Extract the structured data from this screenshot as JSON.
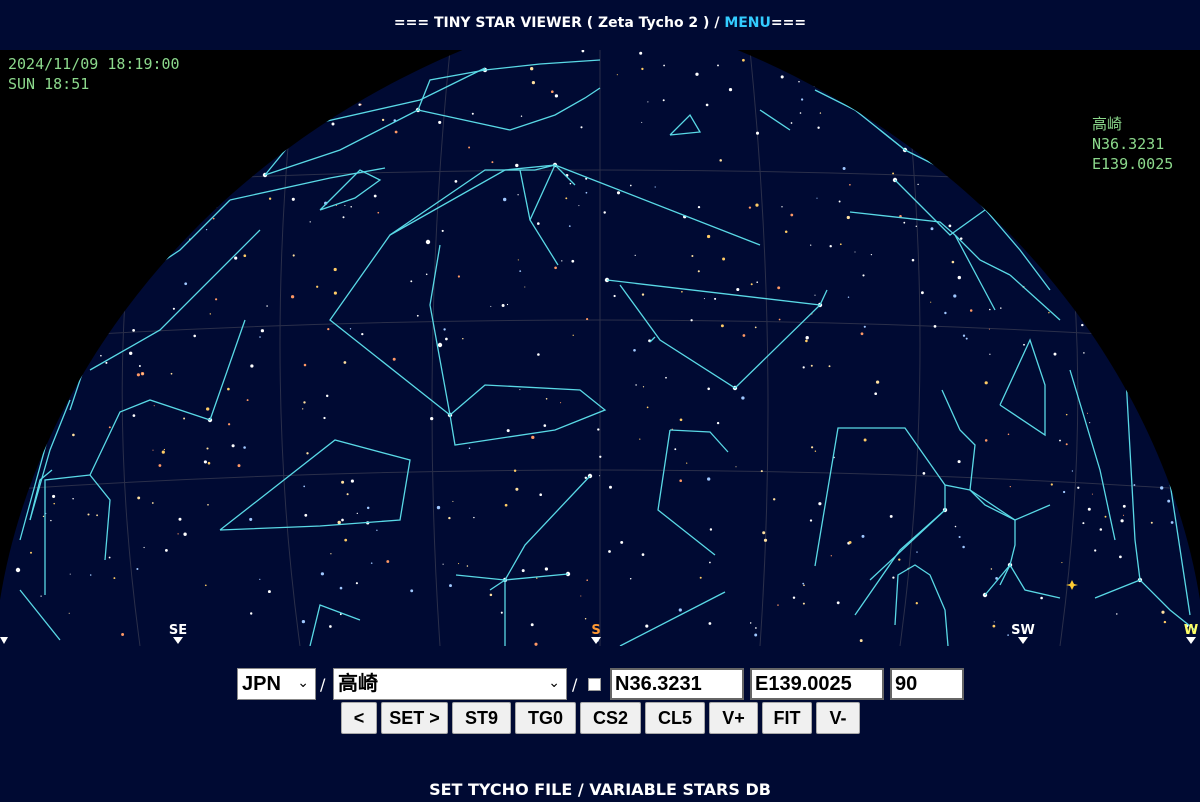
{
  "title": {
    "prefix": "=== TINY STAR VIEWER ( Zeta Tycho 2 ) / ",
    "menu": "MENU",
    "suffix": "==="
  },
  "overlay": {
    "datetime": "2024/11/09 18:19:00",
    "sun": "SUN 18:51",
    "place": "高崎",
    "lat": "N36.3231",
    "lon": "E139.0025"
  },
  "directions": {
    "se": "SE",
    "s": "S",
    "sw": "SW",
    "w": "W"
  },
  "colors": {
    "sky": "#000a33",
    "constellation_line": "#59d9e6",
    "overlay_text": "#8cd98c",
    "menu_link": "#33ccff",
    "south_marker": "#ff9933",
    "west_marker": "#ffff66"
  },
  "controls": {
    "country_select": "JPN",
    "city_select": "高崎",
    "lat_input": "N36.3231",
    "lon_input": "E139.0025",
    "fov_input": "90",
    "sep1": "/",
    "sep2": "/",
    "buttons": {
      "prev": "<",
      "set": "SET >",
      "st9": "ST9",
      "tg0": "TG0",
      "cs2": "CS2",
      "cl5": "CL5",
      "vplus": "V+",
      "fit": "FIT",
      "vminus": "V-"
    }
  },
  "footer": {
    "link": "SET TYCHO FILE / VARIABLE STARS DB"
  }
}
